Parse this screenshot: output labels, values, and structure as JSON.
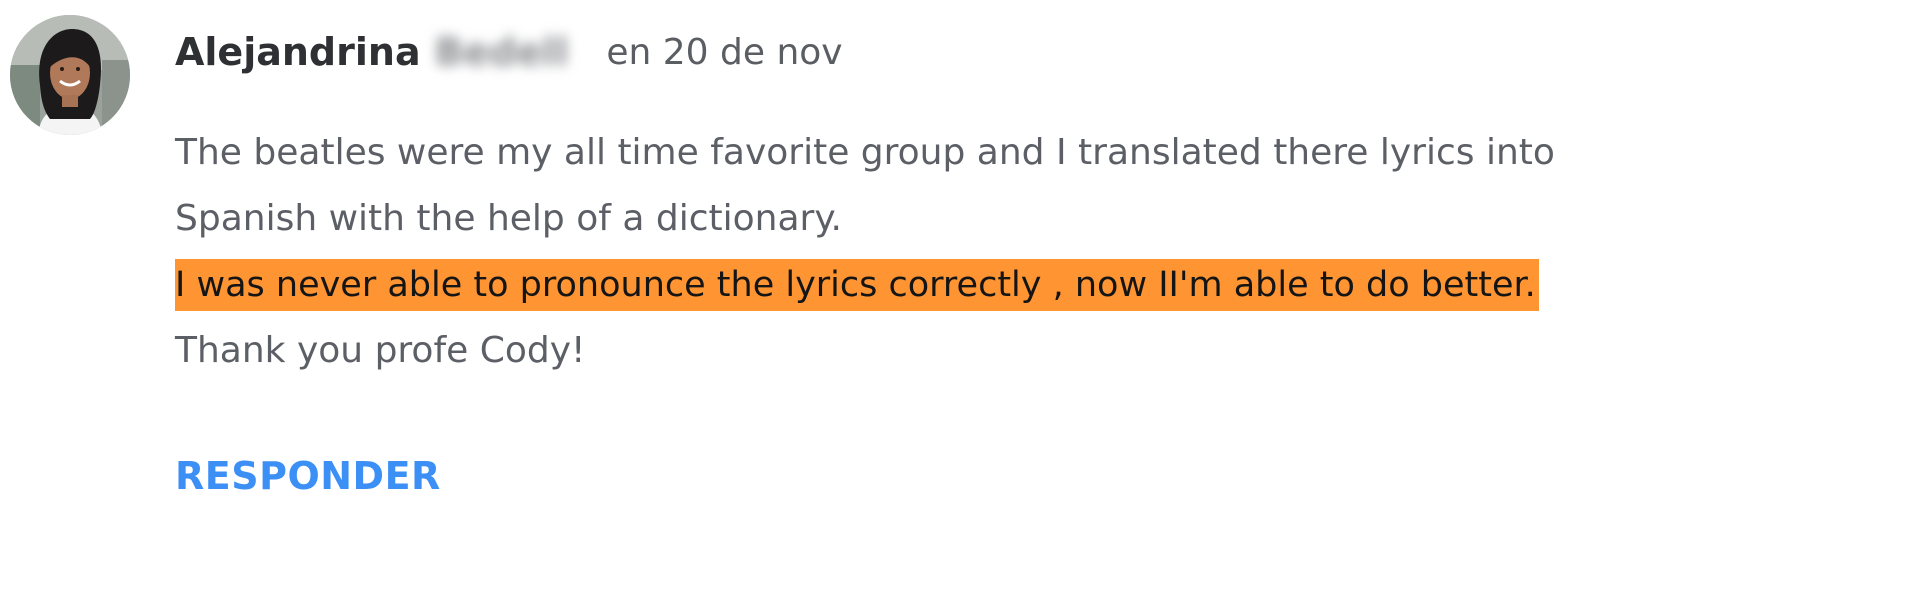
{
  "comment": {
    "author": {
      "first_name": "Alejandrina",
      "last_name": "Bedell"
    },
    "date": "en 20 de nov",
    "lines": [
      "The beatles were my all time favorite group and I translated there lyrics into",
      "Spanish with the help of a dictionary.",
      "I was never able to pronounce the lyrics correctly , now II'm able to do better.",
      "Thank you profe Cody!"
    ],
    "reply_label": "RESPONDER"
  },
  "colors": {
    "highlight": "#ff9433",
    "reply_link": "#3b8ff5",
    "body_text": "#5c6066",
    "author_text": "#2e3033"
  },
  "icons": {
    "avatar": "user-photo-avatar"
  }
}
